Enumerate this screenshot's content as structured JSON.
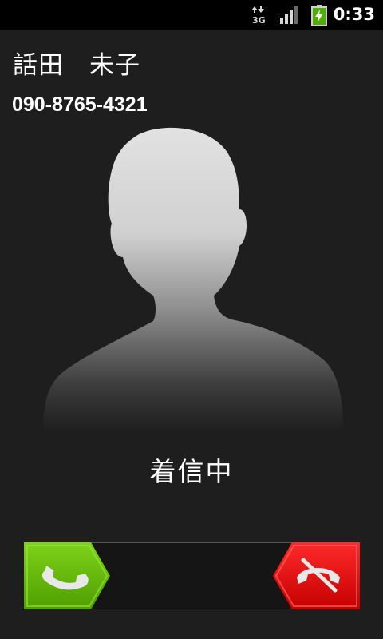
{
  "status_bar": {
    "time": "0:33",
    "network_type": "3G",
    "icons": [
      "3g-data-icon",
      "signal-strength-icon",
      "battery-charging-icon"
    ]
  },
  "caller": {
    "name": "話田　未子",
    "number": "090-8765-4321"
  },
  "call_status": "着信中",
  "slider": {
    "answer_icon": "phone-answer-icon",
    "decline_icon": "phone-decline-icon"
  },
  "colors": {
    "background": "#1e1e1e",
    "status_bar": "#000000",
    "answer": "#6cc000",
    "decline": "#e01010"
  }
}
